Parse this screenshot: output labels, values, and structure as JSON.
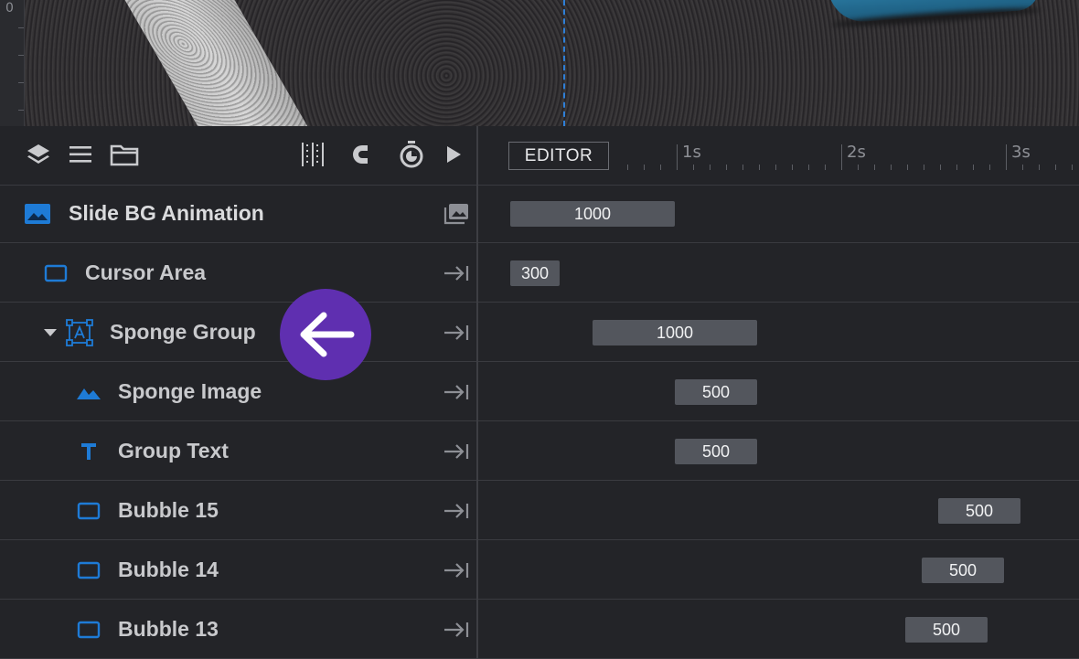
{
  "canvas": {
    "ruler_zero": "0",
    "guide_color": "#2f7fd6"
  },
  "toolbar": {
    "left_icons": [
      "layers-icon",
      "list-icon",
      "folder-icon"
    ],
    "right_icons": [
      "grid-snap-icon",
      "magnet-icon",
      "stopwatch-icon",
      "play-icon"
    ],
    "editor_label": "EDITOR"
  },
  "timescale": {
    "labels": [
      "1s",
      "2s",
      "3s"
    ]
  },
  "layers": [
    {
      "name": "Slide BG Animation",
      "icon": "image-icon",
      "end_icon": "images-icon",
      "bar_value": "1000"
    },
    {
      "name": "Cursor Area",
      "icon": "rectangle-icon",
      "end_icon": "arrow-to-end-icon",
      "bar_value": "300"
    },
    {
      "name": "Sponge Group",
      "icon": "group-icon",
      "end_icon": "arrow-to-end-icon",
      "bar_value": "1000",
      "expanded": true
    },
    {
      "name": "Sponge Image",
      "icon": "mountain-image-icon",
      "end_icon": "arrow-to-end-icon",
      "bar_value": "500"
    },
    {
      "name": "Group Text",
      "icon": "text-icon",
      "end_icon": "arrow-to-end-icon",
      "bar_value": "500"
    },
    {
      "name": "Bubble 15",
      "icon": "rectangle-icon",
      "end_icon": "arrow-to-end-icon",
      "bar_value": "500"
    },
    {
      "name": "Bubble 14",
      "icon": "rectangle-icon",
      "end_icon": "arrow-to-end-icon",
      "bar_value": "500"
    },
    {
      "name": "Bubble 13",
      "icon": "rectangle-icon",
      "end_icon": "arrow-to-end-icon",
      "bar_value": "500"
    }
  ],
  "overlay": {
    "icon": "arrow-left-icon",
    "color": "#5f2fb0"
  },
  "colors": {
    "accent_blue": "#1e7bd6",
    "bar_bg": "#53565d",
    "panel_bg": "#232428"
  }
}
